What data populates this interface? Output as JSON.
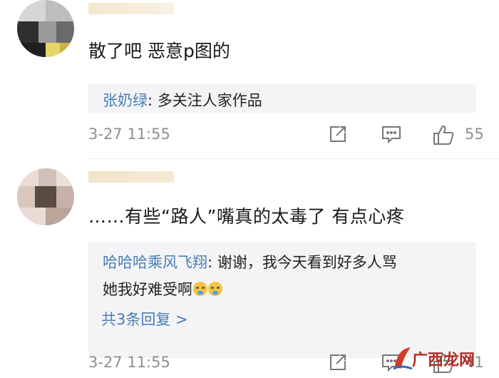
{
  "comments": [
    {
      "text": "散了吧 恶意p图的",
      "reply_name": "张奶绿",
      "reply_text": ": 多关注人家作品",
      "timestamp": "3-27 11:55",
      "like_count": "55"
    },
    {
      "text": "……有些“路人”嘴真的太毒了  有点心疼",
      "reply_name": "哈哈哈乘风飞翔",
      "reply_text_line1": ": 谢谢，我今天看到好多人骂",
      "reply_text_line2": "她我好难受啊",
      "more_replies": "共3条回复 >",
      "timestamp": "3-27 11:55",
      "like_count": "41"
    }
  ],
  "watermark": {
    "text": "广西龙网"
  },
  "colors": {
    "link": "#4a7db8",
    "meta": "#8f8f8f",
    "reply_bg": "#f4f4f6"
  }
}
